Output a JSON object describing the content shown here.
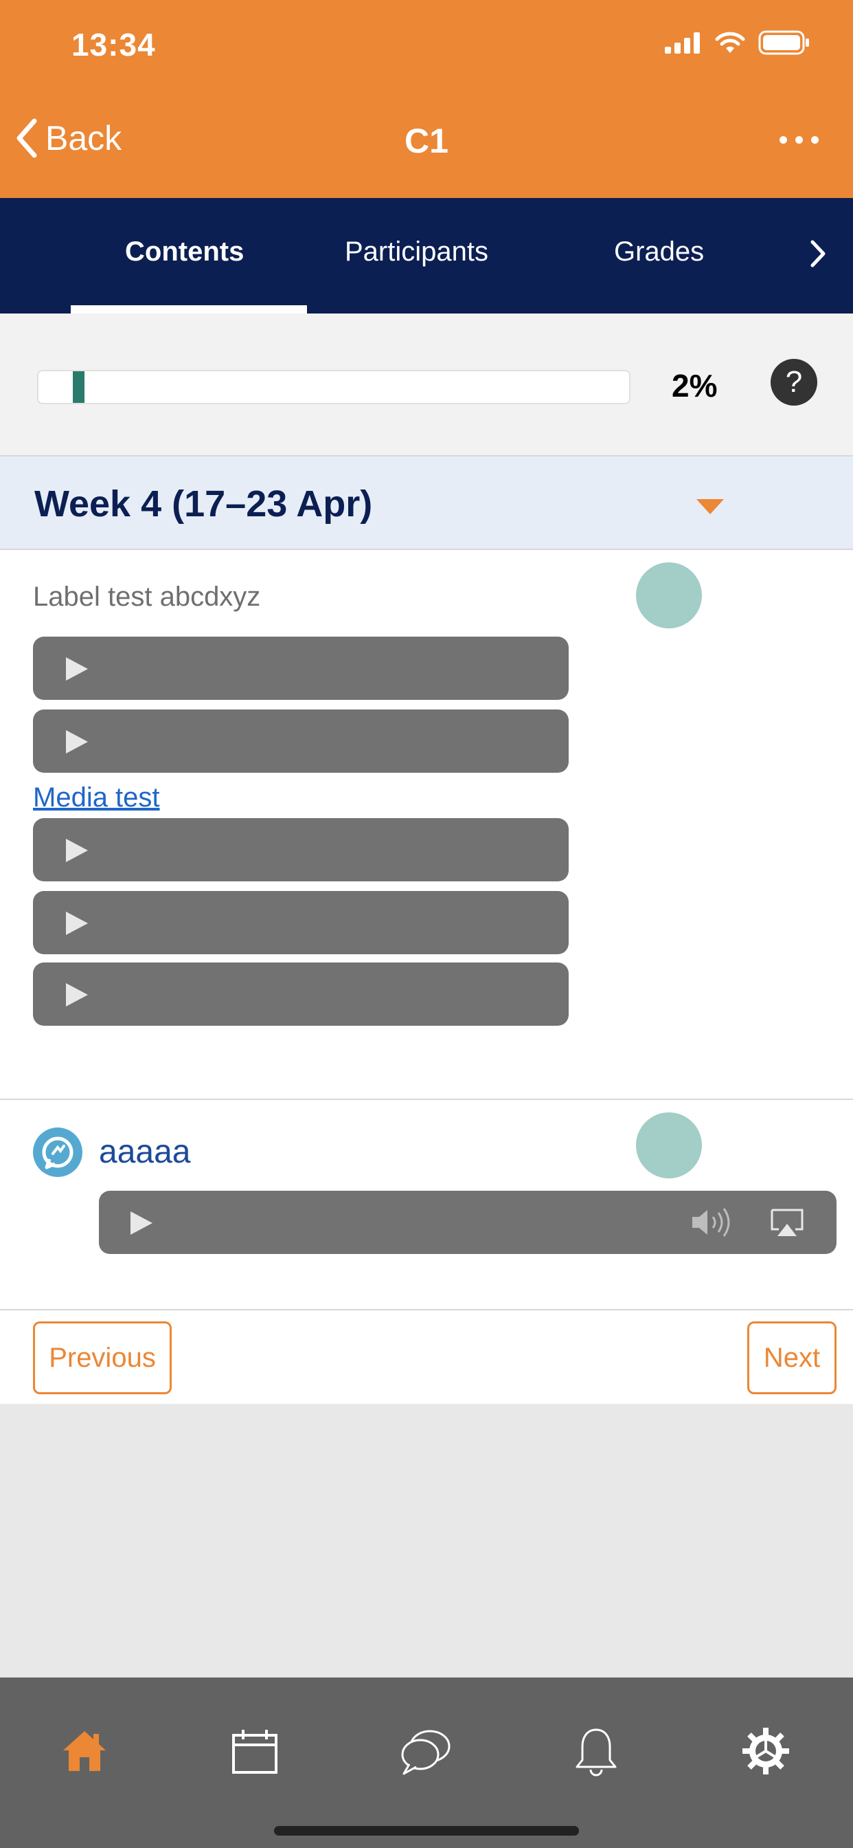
{
  "status_bar": {
    "time": "13:34"
  },
  "nav": {
    "back_label": "Back",
    "title": "C1"
  },
  "tabs": [
    {
      "label": "Contents",
      "active": true
    },
    {
      "label": "Participants",
      "active": false
    },
    {
      "label": "Grades",
      "active": false
    }
  ],
  "progress": {
    "percent_label": "2%",
    "value": 0.02,
    "help_label": "?"
  },
  "section": {
    "title": "Week 4 (17–23 Apr)"
  },
  "content": {
    "label_text": "Label test abcdxyz",
    "media_link": "Media test",
    "activity_name": "aaaaa"
  },
  "pager": {
    "previous_label": "Previous",
    "next_label": "Next"
  },
  "colors": {
    "accent": "#eb8735",
    "navy": "#0b1f53",
    "progress_fill": "#2a7b6c",
    "link": "#1f66c8"
  },
  "bottom_nav": [
    "home-icon",
    "calendar-icon",
    "messages-icon",
    "notifications-icon",
    "settings-icon"
  ]
}
